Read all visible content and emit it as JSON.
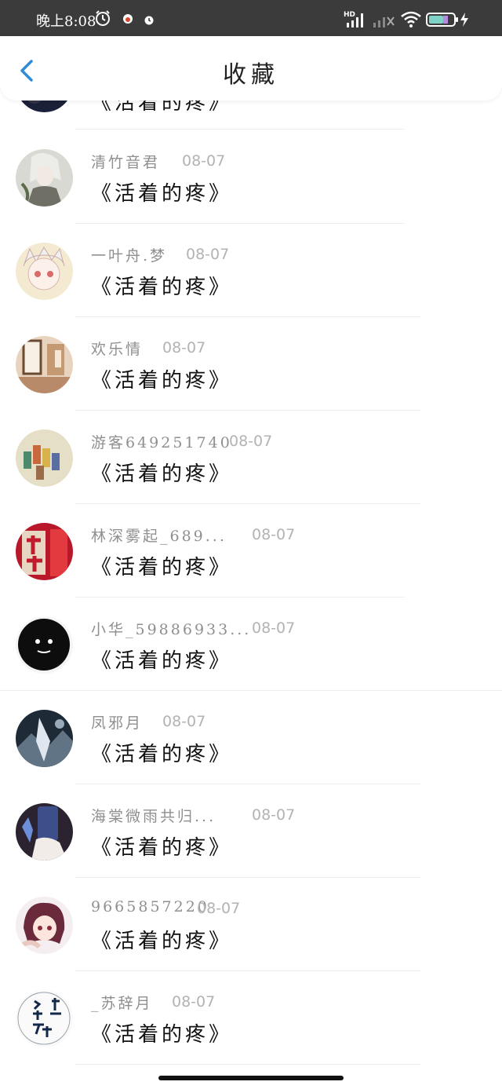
{
  "status_bar": {
    "time": "晚上8:08",
    "network": "HD"
  },
  "header": {
    "title": "收藏"
  },
  "colors": {
    "accent": "#2f8bd8",
    "status_bar_bg": "#3b3b3b",
    "username": "#8f8f8f",
    "date": "#b3b3b3"
  },
  "items": [
    {
      "user": "",
      "date": "",
      "title": "《活着的疼》"
    },
    {
      "user": "清竹音君",
      "date": "08-07",
      "title": "《活着的疼》"
    },
    {
      "user": "一叶舟.梦",
      "date": "08-07",
      "title": "《活着的疼》"
    },
    {
      "user": "欢乐情",
      "date": "08-07",
      "title": "《活着的疼》"
    },
    {
      "user": "游客649251740",
      "date": "08-07",
      "title": "《活着的疼》"
    },
    {
      "user": "林深雾起_689...",
      "date": "08-07",
      "title": "《活着的疼》"
    },
    {
      "user": "小华_59886933...",
      "date": "08-07",
      "title": "《活着的疼》"
    },
    {
      "user": "凤邪月",
      "date": "08-07",
      "title": "《活着的疼》"
    },
    {
      "user": "海棠微雨共归...",
      "date": "08-07",
      "title": "《活着的疼》"
    },
    {
      "user": "9665857220",
      "date": "08-07",
      "title": "《活着的疼》"
    },
    {
      "user": "_苏辞月",
      "date": "08-07",
      "title": "《活着的疼》"
    }
  ]
}
